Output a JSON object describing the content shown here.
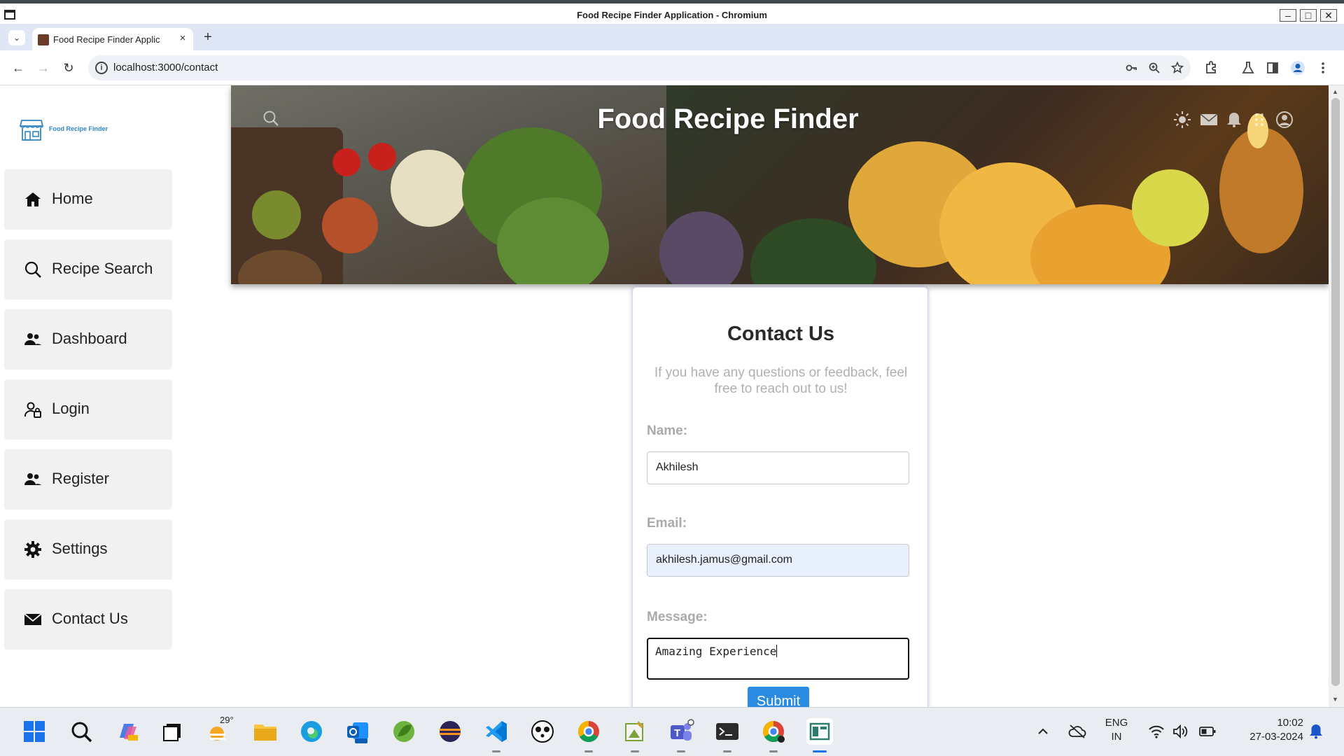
{
  "window": {
    "title": "Food Recipe Finder Application - Chromium",
    "minimize_glyph": "–",
    "maximize_glyph": "□",
    "close_glyph": "✕"
  },
  "browser": {
    "tab_title": "Food Recipe Finder Applic",
    "tab_close": "×",
    "new_tab": "+",
    "url": "localhost:3000/contact",
    "tab_list_glyph": "⌄",
    "back_glyph": "←",
    "forward_glyph": "→",
    "reload_glyph": "↻"
  },
  "sidebar": {
    "logo_text": "Food Recipe Finder",
    "items": [
      {
        "label": "Home",
        "icon": "home-icon"
      },
      {
        "label": "Recipe Search",
        "icon": "search-icon"
      },
      {
        "label": "Dashboard",
        "icon": "users-icon"
      },
      {
        "label": "Login",
        "icon": "user-lock-icon"
      },
      {
        "label": "Register",
        "icon": "users-icon"
      },
      {
        "label": "Settings",
        "icon": "gear-icon"
      },
      {
        "label": "Contact Us",
        "icon": "envelope-icon"
      }
    ]
  },
  "hero": {
    "title": "Food Recipe Finder"
  },
  "contact": {
    "heading": "Contact Us",
    "intro": "If you have any questions or feedback, feel free to reach out to us!",
    "name_label": "Name:",
    "name_value": "Akhilesh",
    "email_label": "Email:",
    "email_value": "akhilesh.jamus@gmail.com",
    "message_label": "Message:",
    "message_value": "Amazing Experience",
    "submit_label": "Submit"
  },
  "taskbar": {
    "weather_temp": "29°",
    "lang_line1": "ENG",
    "lang_line2": "IN",
    "time": "10:02",
    "date": "27-03-2024"
  },
  "colors": {
    "accent": "#2a8be0",
    "logo": "#2f86c8",
    "nav_bg": "#f1f1f1",
    "tabstrip_bg": "#dfe7f7"
  }
}
